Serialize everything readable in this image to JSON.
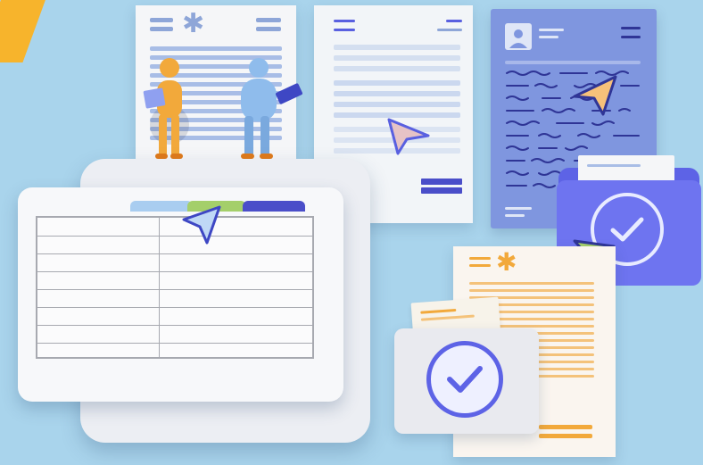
{
  "illustration": {
    "subject": "documents-and-folders",
    "icons": [
      "asterisk-icon",
      "cursor-arrow-icon",
      "checkmark-icon",
      "folder-icon",
      "spreadsheet-icon"
    ],
    "colors": {
      "background": "#a9d4ec",
      "accent_orange": "#f7b42c",
      "indigo": "#5d63e6",
      "lavender_paper": "#7f96df",
      "green_tab": "#a4cf6a",
      "light_blue_tab": "#a9cdf0",
      "navy_tab": "#4a4ec9",
      "figure_orange": "#f2a93b",
      "figure_blue": "#8fbcec"
    }
  }
}
